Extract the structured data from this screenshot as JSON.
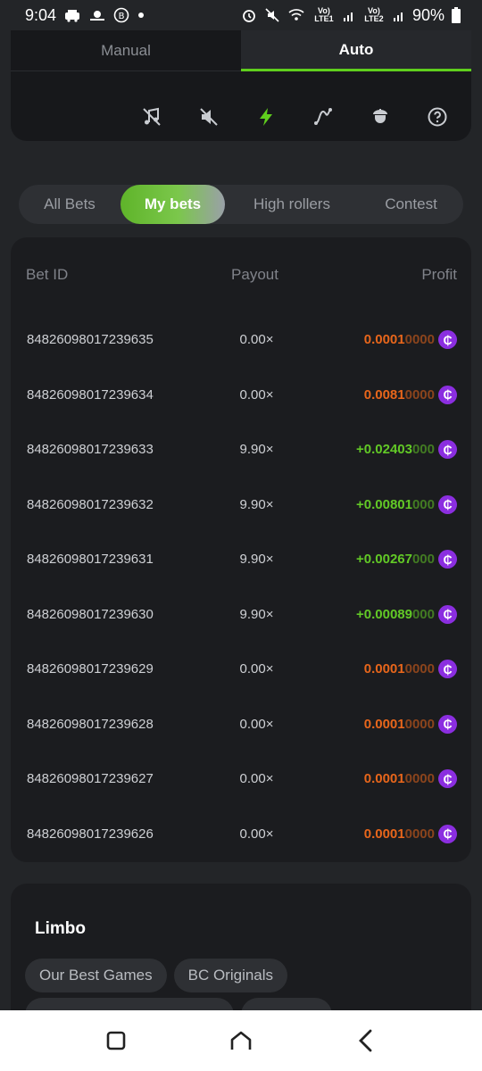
{
  "status_bar": {
    "time": "9:04",
    "network_1": "Vo) LTE1",
    "network_2": "Vo) LTE2",
    "battery": "90%"
  },
  "mode_tabs": [
    {
      "label": "Manual",
      "active": false
    },
    {
      "label": "Auto",
      "active": true
    }
  ],
  "tools": [
    "music-off-icon",
    "sound-off-icon",
    "lightning-icon",
    "curve-icon",
    "acorn-icon",
    "help-icon"
  ],
  "bet_tabs": [
    {
      "label": "All Bets",
      "active": false
    },
    {
      "label": "My bets",
      "active": true
    },
    {
      "label": "High rollers",
      "active": false
    },
    {
      "label": "Contest",
      "active": false
    }
  ],
  "table": {
    "headers": {
      "id": "Bet ID",
      "payout": "Payout",
      "profit": "Profit"
    },
    "rows": [
      {
        "id": "84826098017239635",
        "payout": "0.00×",
        "profit_main": "0.0001",
        "profit_tail": "0000",
        "sign": "",
        "color": "#e8661b"
      },
      {
        "id": "84826098017239634",
        "payout": "0.00×",
        "profit_main": "0.0081",
        "profit_tail": "0000",
        "sign": "",
        "color": "#e8661b"
      },
      {
        "id": "84826098017239633",
        "payout": "9.90×",
        "profit_main": "+0.02403",
        "profit_tail": "000",
        "sign": "+",
        "color": "#62c926"
      },
      {
        "id": "84826098017239632",
        "payout": "9.90×",
        "profit_main": "+0.00801",
        "profit_tail": "000",
        "sign": "+",
        "color": "#62c926"
      },
      {
        "id": "84826098017239631",
        "payout": "9.90×",
        "profit_main": "+0.00267",
        "profit_tail": "000",
        "sign": "+",
        "color": "#62c926"
      },
      {
        "id": "84826098017239630",
        "payout": "9.90×",
        "profit_main": "+0.00089",
        "profit_tail": "000",
        "sign": "+",
        "color": "#62c926"
      },
      {
        "id": "84826098017239629",
        "payout": "0.00×",
        "profit_main": "0.0001",
        "profit_tail": "0000",
        "sign": "",
        "color": "#e8661b"
      },
      {
        "id": "84826098017239628",
        "payout": "0.00×",
        "profit_main": "0.0001",
        "profit_tail": "0000",
        "sign": "",
        "color": "#e8661b"
      },
      {
        "id": "84826098017239627",
        "payout": "0.00×",
        "profit_main": "0.0001",
        "profit_tail": "0000",
        "sign": "",
        "color": "#e8661b"
      },
      {
        "id": "84826098017239626",
        "payout": "0.00×",
        "profit_main": "0.0001",
        "profit_tail": "0000",
        "sign": "",
        "color": "#e8661b"
      }
    ],
    "coin_symbol": "₵"
  },
  "limbo": {
    "title": "Limbo",
    "chips": [
      "Our Best Games",
      "BC Originals"
    ]
  },
  "colors": {
    "accent_green": "#5fce1d",
    "loss_orange": "#e8661b",
    "win_green": "#62c926",
    "coin_purple": "#8b2ee0"
  }
}
